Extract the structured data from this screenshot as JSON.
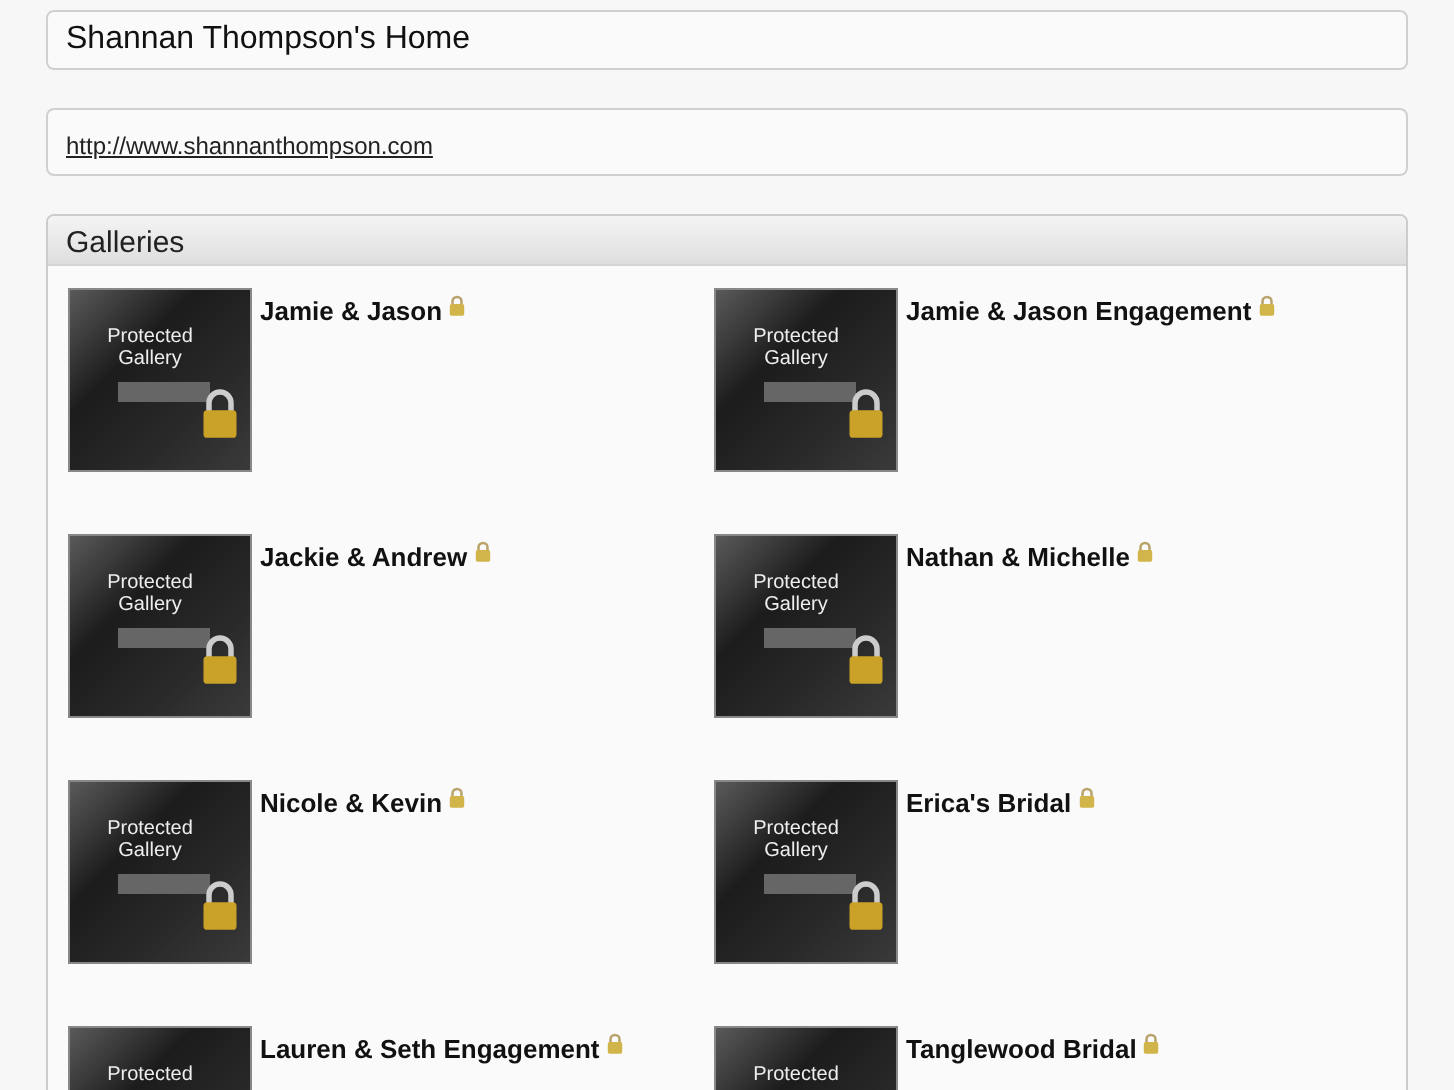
{
  "page_title": "Shannan Thompson's Home",
  "website_link": "http://www.shannanthompson.com",
  "galleries_panel": {
    "heading": "Galleries",
    "galleries": [
      {
        "name": "Jamie & Jason",
        "thumbnail_lines": [
          "Protected",
          "Gallery"
        ]
      },
      {
        "name": "Jamie & Jason Engagement",
        "thumbnail_lines": [
          "Protected",
          "Gallery"
        ]
      },
      {
        "name": "Jackie & Andrew",
        "thumbnail_lines": [
          "Protected",
          "Gallery"
        ]
      },
      {
        "name": "Nathan & Michelle",
        "thumbnail_lines": [
          "Protected",
          "Gallery"
        ]
      },
      {
        "name": "Nicole & Kevin",
        "thumbnail_lines": [
          "Protected",
          "Gallery"
        ]
      },
      {
        "name": "Erica's Bridal",
        "thumbnail_lines": [
          "Protected",
          "Gallery"
        ]
      },
      {
        "name": "Lauren & Seth Engagement",
        "thumbnail_lines": [
          "Protected"
        ]
      },
      {
        "name": "Tanglewood Bridal",
        "thumbnail_lines": [
          "Protected"
        ]
      }
    ]
  }
}
